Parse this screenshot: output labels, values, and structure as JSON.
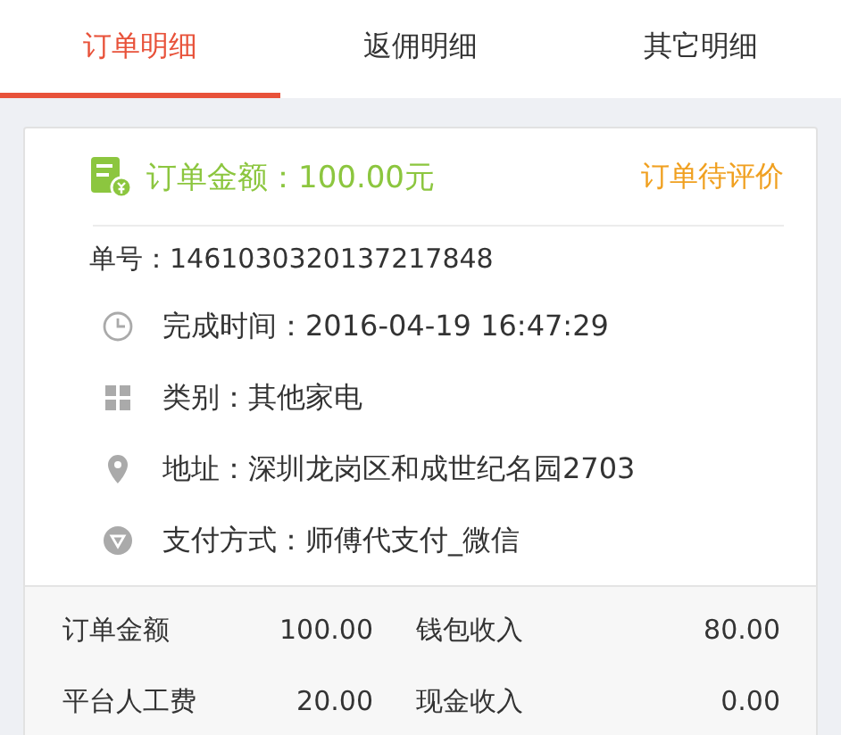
{
  "tabs": [
    {
      "label": "订单明细",
      "selected": true
    },
    {
      "label": "返佣明细",
      "selected": false
    },
    {
      "label": "其它明细",
      "selected": false
    }
  ],
  "order": {
    "amount_text": "订单金额：100.00元",
    "status": "订单待评价",
    "number": "单号：1461030320137217848",
    "details": [
      {
        "kind": "clock",
        "text": "完成时间：2016-04-19 16:47:29"
      },
      {
        "kind": "grid",
        "text": "类别：其他家电"
      },
      {
        "kind": "pin",
        "text": "地址：深圳龙岗区和成世纪名园2703"
      },
      {
        "kind": "shield",
        "text": "支付方式：师傅代支付_微信"
      }
    ]
  },
  "summary": [
    {
      "label_1": "订单金额",
      "value_1": "100.00",
      "label_2": "钱包收入",
      "value_2": "80.00"
    },
    {
      "label_1": "平台人工费",
      "value_1": "20.00",
      "label_2": "现金收入",
      "value_2": "0.00"
    }
  ]
}
